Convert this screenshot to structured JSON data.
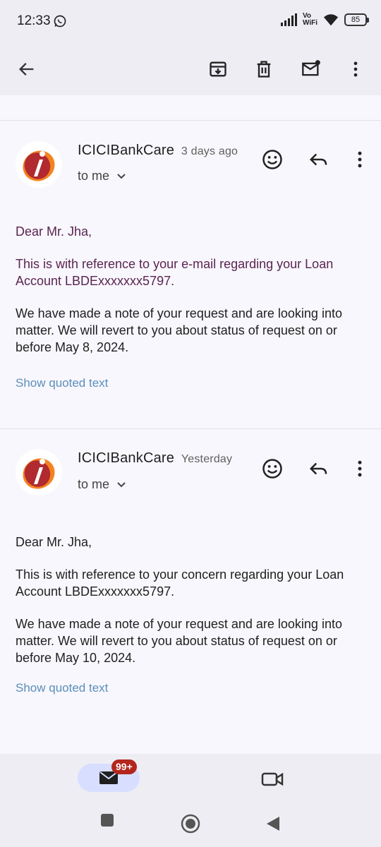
{
  "status": {
    "time": "12:33",
    "network_label_top": "Vo",
    "network_label_bottom": "WiFi",
    "battery": "85"
  },
  "toolbar": {
    "back_icon": "arrow-back-icon",
    "archive_icon": "archive-icon",
    "delete_icon": "trash-icon",
    "mark_unread_icon": "mark-unread-icon",
    "more_icon": "more-vert-icon"
  },
  "emails": [
    {
      "sender": "ICICIBankCare",
      "time": "3 days ago",
      "to": "to me",
      "paragraphs": [
        "Dear Mr. Jha,",
        "This is with reference to your e-mail regarding your Loan Account LBDExxxxxxx5797.",
        "We have made a note of your request and are looking into matter. We will revert to you about status of request on or before May 8, 2024."
      ],
      "quoted": "Show quoted text"
    },
    {
      "sender": "ICICIBankCare",
      "time": "Yesterday",
      "to": "to me",
      "paragraphs": [
        "Dear Mr. Jha,",
        "This is with reference to your concern regarding your Loan Account LBDExxxxxxx5797.",
        "We have made a note of your request and are looking into matter. We will revert to you about status of request on or before May 10, 2024."
      ],
      "quoted": "Show quoted text"
    }
  ],
  "bottom_nav": {
    "mail_badge": "99+",
    "mail_icon": "mail-icon",
    "meet_icon": "video-camera-icon"
  },
  "colors": {
    "purple_text": "#5a2450",
    "link": "#5b8fb9",
    "badge": "#b3261e",
    "nav_active": "#d8deff"
  }
}
